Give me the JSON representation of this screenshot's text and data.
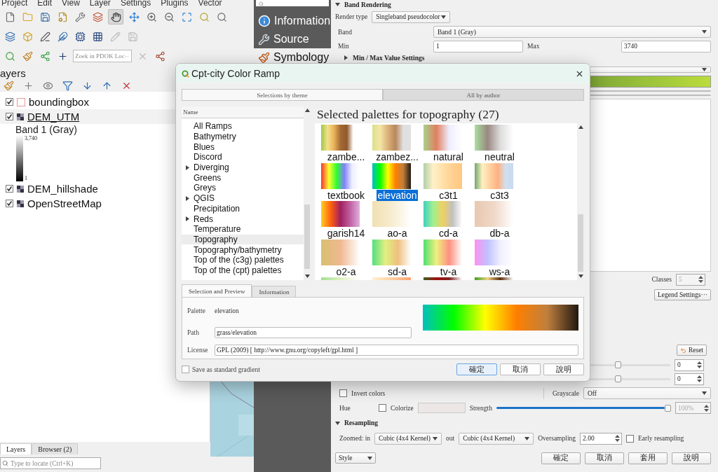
{
  "menu_bar": [
    "Project",
    "Edit",
    "View",
    "Layer",
    "Settings",
    "Plugins",
    "Vector"
  ],
  "locator_toolbar": {
    "placeholder": "Zoek in PDOK Loc···"
  },
  "layers_panel": {
    "title": "ayers",
    "layers": [
      {
        "name": "boundingbox",
        "kind": "vector",
        "checked": true,
        "current": false
      },
      {
        "name": "DEM_UTM",
        "kind": "raster",
        "checked": true,
        "current": true,
        "legend": {
          "band": "Band 1 (Gray)",
          "max": "3,740",
          "min": "1"
        }
      },
      {
        "name": "DEM_hillshade",
        "kind": "raster",
        "checked": true,
        "current": false
      },
      {
        "name": "OpenStreetMap",
        "kind": "raster",
        "checked": true,
        "current": false
      }
    ],
    "tabs": [
      {
        "label": "Layers",
        "selected": true
      },
      {
        "label": "Browser (2)",
        "selected": false
      }
    ],
    "locate": {
      "placeholder": "Type to locate (Ctrl+K)"
    }
  },
  "properties": {
    "sidebar": [
      {
        "label": "Information",
        "selected": false
      },
      {
        "label": "Source",
        "selected": false
      },
      {
        "label": "Symbology",
        "selected": true
      }
    ],
    "band_rendering": {
      "title": "Band Rendering",
      "expanded": true,
      "render_type_label": "Render type",
      "render_type": "Singleband pseudocolor",
      "band_label": "Band",
      "band": "Band 1 (Gray)",
      "min_label": "Min",
      "min": "1",
      "max_label": "Max",
      "max": "3740",
      "minmax_title": "Min / Max Value Settings",
      "minmax_expanded": false,
      "classes_label": "Classes",
      "classes": "5",
      "legend_button": "Legend Settings···"
    },
    "color_rendering": {
      "reset": "Reset",
      "sliders": [
        {
          "level": 0.35,
          "value": "0"
        },
        {
          "level": 0.35,
          "value": "0"
        }
      ],
      "invert_label": "Invert colors",
      "invert": false,
      "grayscale_label": "Grayscale",
      "grayscale": "Off",
      "hue_label": "Hue",
      "colorize_label": "Colorize",
      "colorize": false,
      "strength_label": "Strength",
      "strength": {
        "level": 1,
        "value": "100%"
      }
    },
    "resampling": {
      "title": "Resampling",
      "expanded": true,
      "zoomed_in_label": "Zoomed: in",
      "zoomed_in": "Cubic (4x4 Kernel)",
      "out_label": "out",
      "zoomed_out": "Cubic (4x4 Kernel)",
      "oversampling_label": "Oversampling",
      "oversampling": "2.00",
      "early_label": "Early resampling",
      "early": false
    },
    "style_button": "Style",
    "buttons": [
      "確定",
      "取消",
      "套用",
      "說明"
    ]
  },
  "dialog": {
    "title": "Cpt-city Color Ramp",
    "tabs": [
      {
        "label": "Selections by theme",
        "selected": true
      },
      {
        "label": "All by author",
        "selected": false
      }
    ],
    "tree_header": "Name",
    "tree": [
      {
        "label": "All Ramps",
        "has_children": false,
        "selected": false
      },
      {
        "label": "Bathymetry",
        "has_children": false,
        "selected": false
      },
      {
        "label": "Blues",
        "has_children": false,
        "selected": false
      },
      {
        "label": "Discord",
        "has_children": false,
        "selected": false
      },
      {
        "label": "Diverging",
        "has_children": true,
        "selected": false
      },
      {
        "label": "Greens",
        "has_children": false,
        "selected": false
      },
      {
        "label": "Greys",
        "has_children": false,
        "selected": false
      },
      {
        "label": "QGIS",
        "has_children": true,
        "selected": false
      },
      {
        "label": "Precipitation",
        "has_children": false,
        "selected": false
      },
      {
        "label": "Reds",
        "has_children": true,
        "selected": false
      },
      {
        "label": "Temperature",
        "has_children": false,
        "selected": false
      },
      {
        "label": "Topography",
        "has_children": false,
        "selected": true
      },
      {
        "label": "Topography/bathymetry",
        "has_children": false,
        "selected": false
      },
      {
        "label": "Top of the (c3g) palettes",
        "has_children": false,
        "selected": false
      },
      {
        "label": "Top of the (cpt) palettes",
        "has_children": false,
        "selected": false
      }
    ],
    "heading": "Selected palettes for topography (27)",
    "palettes": [
      {
        "name": "zambe...",
        "selected": false
      },
      {
        "name": "zambez...",
        "selected": false
      },
      {
        "name": "natural",
        "selected": false
      },
      {
        "name": "neutral",
        "selected": false
      },
      {
        "name": "textbook",
        "selected": false
      },
      {
        "name": "elevation",
        "selected": true
      },
      {
        "name": "c3t1",
        "selected": false
      },
      {
        "name": "c3t3",
        "selected": false
      },
      {
        "name": "garish14",
        "selected": false
      },
      {
        "name": "ao-a",
        "selected": false
      },
      {
        "name": "cd-a",
        "selected": false
      },
      {
        "name": "db-a",
        "selected": false
      },
      {
        "name": "o2-a",
        "selected": false
      },
      {
        "name": "sd-a",
        "selected": false
      },
      {
        "name": "tv-a",
        "selected": false
      },
      {
        "name": "ws-a",
        "selected": false
      },
      {
        "selected": false
      },
      {
        "selected": false
      },
      {
        "selected": false
      },
      {
        "selected": false
      }
    ],
    "bottom_tabs": [
      {
        "label": "Selection and Preview",
        "selected": true
      },
      {
        "label": "Information",
        "selected": false
      }
    ],
    "palette_label": "Palette",
    "palette": "elevation",
    "path_label": "Path",
    "path": "grass/elevation",
    "license_label": "License",
    "license": "GPL (2009)  [ http://www.gnu.org/copyleft/gpl.html ]",
    "save_label": "Save as standard gradient",
    "save": false,
    "buttons": [
      {
        "label": "確定",
        "default": true
      },
      {
        "label": "取消",
        "default": false
      },
      {
        "label": "說明",
        "default": false
      }
    ]
  }
}
